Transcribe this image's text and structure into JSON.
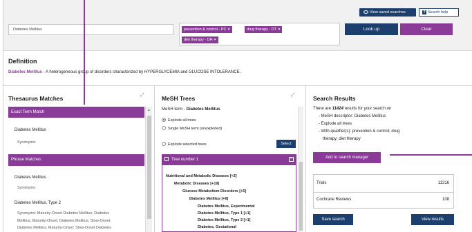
{
  "colors": {
    "purple": "#8a3a97",
    "navy": "#1d3f6e",
    "topbar_bg": "#f1f1f1"
  },
  "header": {
    "view_saved_label": "View saved searches",
    "view_saved_icon": "eye-icon",
    "help_label": "Search help",
    "help_icon": "question-icon"
  },
  "search": {
    "value": "Diabetes Mellitus",
    "tags": [
      {
        "label": "prevention & control - PC"
      },
      {
        "label": "drug therapy - DT"
      },
      {
        "label": "diet therapy - DH"
      }
    ],
    "lookup_label": "Look up",
    "clear_label": "Clear"
  },
  "definition": {
    "title": "Definition",
    "term": "Diabetes Mellitus",
    "text": " - A heterogeneous group of disorders characterized by HYPERGLYCEMIA and GLUCOSE INTOLERANCE."
  },
  "thesaurus": {
    "title": "Thesaurus Matches",
    "exact_header": "Exact Term Match",
    "exact_term": "Diabetes Mellitus",
    "exact_synonyms": "Synonyms:",
    "phrase_header": "Phrase Matches",
    "phrase_items": [
      {
        "term": "Diabetes Mellitus",
        "synonyms": "Synonyms:"
      },
      {
        "term": "Diabetes Mellitus, Type 2",
        "synonyms": "Synonyms: Maturity-Onset Diabetes Mellitus; Diabetes"
      }
    ],
    "phrase_cont_1": "Mellitus, Maturity-Onset; Diabetes Mellitus, Slow-Onset;",
    "phrase_cont_2": "Diabetes Mellitus, Maturity-Onset; Slow-Onset Diabetes"
  },
  "mesh": {
    "title": "MeSH Trees",
    "term_prefix": "MeSH term - ",
    "term": "Diabetes Mellitus",
    "options": [
      "Explode all trees",
      "Single MeSH term (unexploded)"
    ],
    "explode_selected": "Explode selected trees",
    "select_label": "Select",
    "tree_header": "Tree number 1",
    "tree_lines": [
      "Nutritional and Metabolic Diseases [+2]",
      "Metabolic Diseases [+19]",
      "Glucose Metabolism Disorders [+5]",
      "Diabetes Mellitus [+6]",
      "Diabetes Mellitus, Experimental",
      "Diabetes Mellitus, Type 1 [+1]",
      "Diabetes Mellitus, Type 2 [+1]",
      "Diabetes, Gestational"
    ]
  },
  "results": {
    "title": "Search Results",
    "summary_pre": "There are ",
    "summary_count": "11424",
    "summary_post": " results for your search on",
    "bullets": [
      "MeSH descriptor: Diabetes Mellitus",
      "Explode all trees",
      "With qualifier(s): prevention & control; drug",
      "therapy; diet therapy"
    ],
    "add_label": "Add to search manager",
    "rows": [
      {
        "label": "Trials",
        "value": "11316"
      },
      {
        "label": "Cochrane Reviews",
        "value": "108"
      }
    ],
    "save_label": "Save search",
    "view_label": "View results"
  }
}
